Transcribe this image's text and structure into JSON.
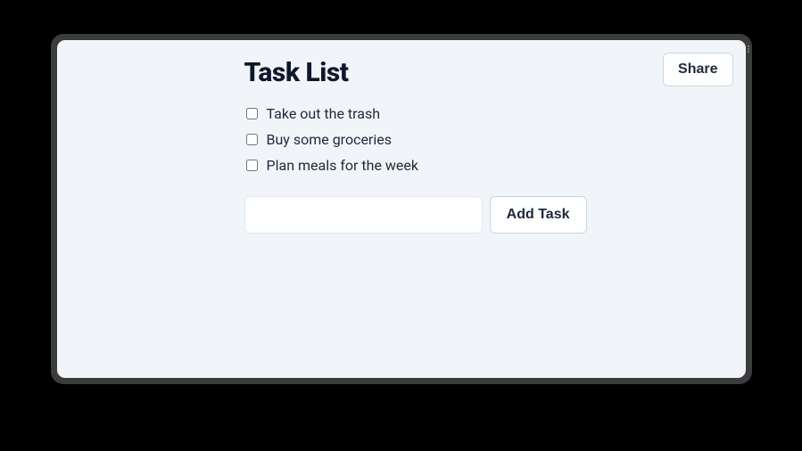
{
  "header": {
    "title": "Task List",
    "share_label": "Share"
  },
  "tasks": [
    {
      "label": "Take out the trash",
      "checked": false
    },
    {
      "label": "Buy some groceries",
      "checked": false
    },
    {
      "label": "Plan meals for the week",
      "checked": false
    }
  ],
  "new_task": {
    "value": "",
    "placeholder": ""
  },
  "buttons": {
    "add_task": "Add Task"
  }
}
